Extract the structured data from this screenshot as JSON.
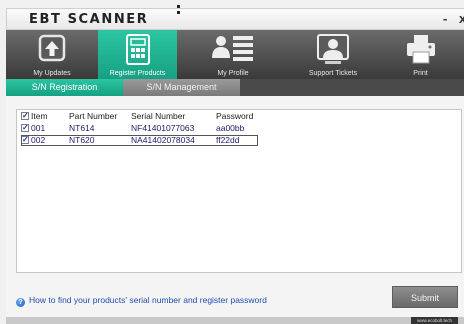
{
  "app": {
    "title": "EBT SCANNER",
    "minimize": "-",
    "close": "x"
  },
  "nav": {
    "items": [
      {
        "label": "My Updates",
        "icon": "upload-arrow-icon"
      },
      {
        "label": "Register Products",
        "icon": "register-grid-icon"
      },
      {
        "label": "My Profile",
        "icon": "profile-list-icon"
      },
      {
        "label": "Support Tickets",
        "icon": "support-person-icon"
      },
      {
        "label": "Print",
        "icon": "printer-icon"
      }
    ],
    "active": "Register Products"
  },
  "subtabs": [
    {
      "label": "S/N Registration"
    },
    {
      "label": "S/N Management"
    }
  ],
  "table": {
    "headers": {
      "item": "Item",
      "part": "Part Number",
      "serial": "Serial Number",
      "password": "Password"
    },
    "rows": [
      {
        "item": "001",
        "part": "NT614",
        "serial": "NF41401077063",
        "password": "aa00bb"
      },
      {
        "item": "002",
        "part": "NT620",
        "serial": "NA41402078034",
        "password": "ff22dd"
      }
    ]
  },
  "help_link": "How to find your products' serial number and register password",
  "submit_label": "Submit",
  "footer_brand": "www.ecobolt.tech",
  "colors": {
    "accent": "#1fb592",
    "nav_bg": "#4a4a4a",
    "link": "#1f4fb0"
  }
}
